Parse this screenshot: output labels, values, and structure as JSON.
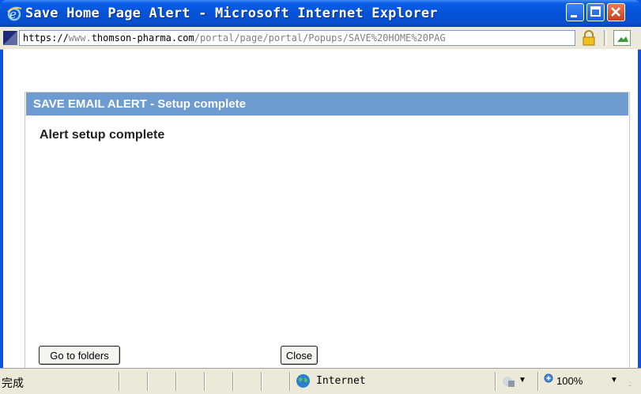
{
  "window": {
    "title": "Save Home Page Alert - Microsoft Internet Explorer"
  },
  "address": {
    "url_prefix": "https://",
    "url_host_a": "www.",
    "url_host_b": "thomson-pharma.com",
    "url_path": "/portal/page/portal/Popups/SAVE%20HOME%20PAG"
  },
  "dialog": {
    "header": "SAVE EMAIL ALERT - Setup complete",
    "message": "Alert setup complete",
    "btn_folders": "Go to folders",
    "btn_close": "Close"
  },
  "status": {
    "text": "完成",
    "zone": "Internet",
    "zoom": "100%"
  },
  "colors": {
    "titlebar": "#0a55e4",
    "dialog_header": "#6e9cd0"
  }
}
